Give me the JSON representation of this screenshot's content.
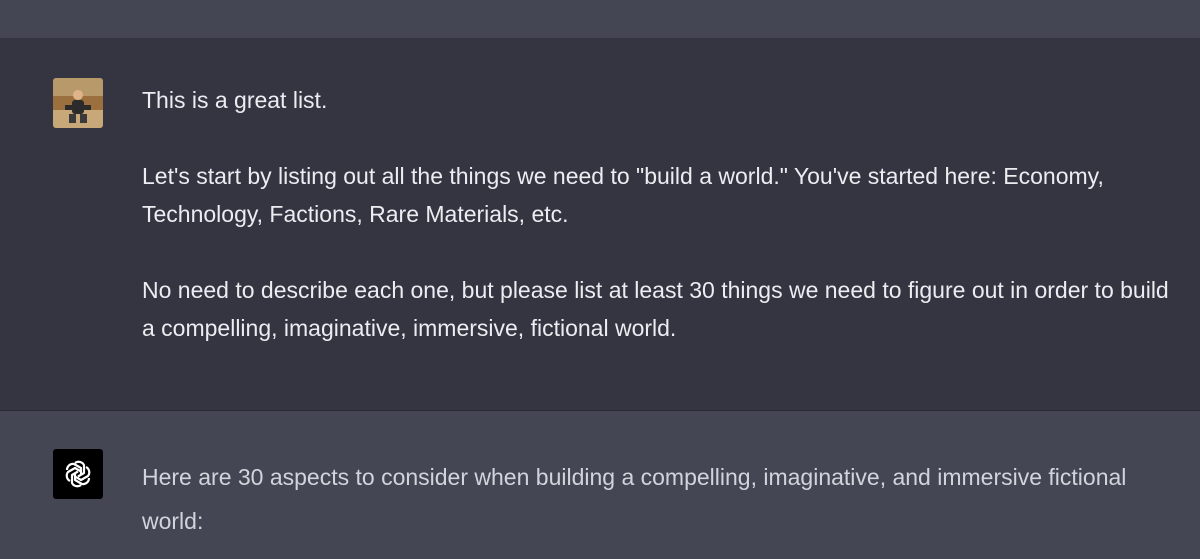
{
  "colors": {
    "user_bg": "#343541",
    "assistant_bg": "#444654",
    "text": "#ececf1",
    "assistant_text": "#d1d5db",
    "bot_avatar_bg": "#000000"
  },
  "user_turn": {
    "avatar_icon": "user-photo-avatar",
    "paragraphs": [
      "This is a great list.",
      "Let's start by listing out all the things we need to \"build a world.\" You've started here: Economy, Technology, Factions, Rare Materials, etc.",
      "No need to describe each one, but please list at least 30 things we need to figure out in order to build a compelling, imaginative, immersive, fictional world."
    ]
  },
  "assistant_turn": {
    "avatar_icon": "openai-logo-icon",
    "text": "Here are 30 aspects to consider when building a compelling, imaginative, and immersive fictional world:"
  }
}
